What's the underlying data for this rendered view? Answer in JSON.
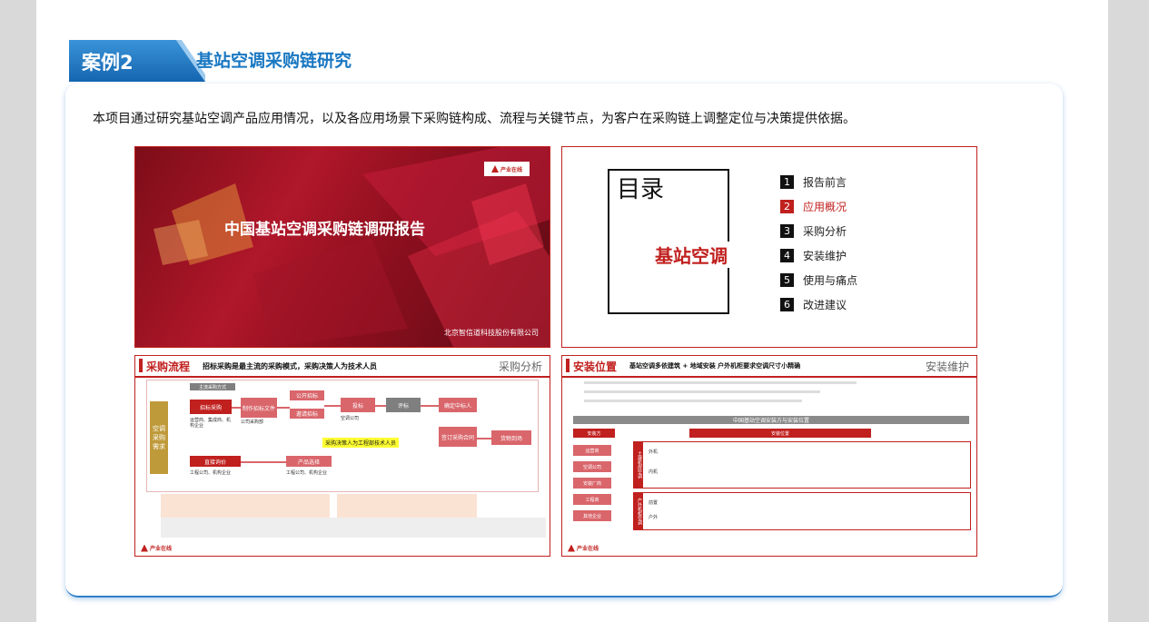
{
  "header": {
    "case_label": "案例2",
    "title": "基站空调采购链研究"
  },
  "description": "本项目通过研究基站空调产品应用情况，以及各应用场景下采购链构成、流程与关键节点，为客户在采购链上调整定位与决策提供依据。",
  "colors": {
    "brand_blue": "#1a78c2",
    "accent_red": "#c0201e"
  },
  "slides": {
    "cover": {
      "title": "中国基站空调采购链调研报告",
      "company": "北京智信道科技股份有限公司",
      "logo_text": "产业在线"
    },
    "toc": {
      "heading": "目录",
      "subject": "基站空调",
      "items": [
        {
          "num": "1",
          "label": "报告前言"
        },
        {
          "num": "2",
          "label": "应用概况"
        },
        {
          "num": "3",
          "label": "采购分析"
        },
        {
          "num": "4",
          "label": "安装维护"
        },
        {
          "num": "5",
          "label": "使用与痛点"
        },
        {
          "num": "6",
          "label": "改进建议"
        }
      ]
    },
    "process": {
      "title": "采购流程",
      "subtitle": "招标采购是最主流的采购模式，采购决策人为技术人员",
      "section": "采购分析",
      "main_mode": "主流采购方式",
      "bidding": "招标采购",
      "prepare_doc": "制作招标文件",
      "open_bid": "公开招标",
      "invite_bid": "邀请招标",
      "submit_bid": "投标",
      "evaluate": "评标",
      "winner": "确定中标人",
      "contract": "签订采购合同",
      "delivery": "货物到场",
      "direct_inquiry": "直接询价",
      "product_select": "产品选择",
      "demand": "空调采购需求",
      "decision_note": "采购决策人为工程部技术人员",
      "parties_1": "运营商、集成商、机构企业",
      "party_a": "公司采购部",
      "party_b": "空调公司",
      "party_c": "工程公司、机构企业",
      "party_d": "工程公司、机构企业"
    },
    "install": {
      "title": "安装位置",
      "subtitle": "基站空调多依建筑 + 地域安装  户外机柜要求空调尺寸小精确",
      "section": "安装维护",
      "table_title": "中国基站空调安装方与安装位置",
      "left_header": "安装方",
      "right_header": "安装位置",
      "installers": [
        "运营商",
        "空调公司",
        "安装厂商",
        "工程商",
        "其他企业"
      ],
      "groups": [
        {
          "name": "土建机房空调",
          "rows": [
            "外机",
            "内机"
          ]
        },
        {
          "name": "户外机柜空调",
          "rows": [
            "前置",
            "户外"
          ]
        }
      ]
    }
  }
}
